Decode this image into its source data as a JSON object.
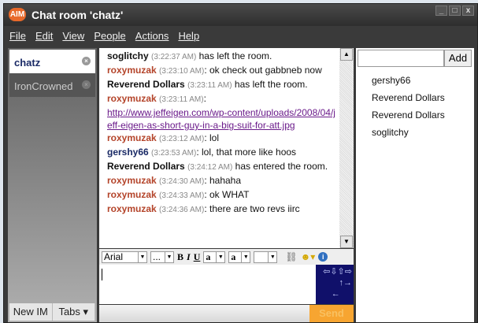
{
  "window": {
    "logo": "AIM",
    "title": "Chat room 'chatz'",
    "controls": [
      "_",
      "□",
      "x"
    ]
  },
  "menu": [
    "File",
    "Edit",
    "View",
    "People",
    "Actions",
    "Help"
  ],
  "sidebar": {
    "tabs": [
      {
        "label": "chatz"
      },
      {
        "label": "IronCrowned"
      }
    ],
    "close": "×",
    "new_im": "New IM",
    "tabs_btn": "Tabs ▾"
  },
  "messages": [
    {
      "name": "soglitchy",
      "color": "k",
      "time": "(3:22:37 AM)",
      "text": " has left the room."
    },
    {
      "name": "roxymuzak",
      "color": "r",
      "time": "(3:23:10 AM)",
      "text": ": ok check out gabbneb now"
    },
    {
      "name": "Reverend Dollars",
      "color": "k",
      "time": "(3:23:11 AM)",
      "text": " has left the room."
    },
    {
      "name": "roxymuzak",
      "color": "r",
      "time": "(3:23:11 AM)",
      "text": ":",
      "link": "http://www.jeffeigen.com/wp-content/uploads/2008/04/jeff-eigen-as-short-guy-in-a-big-suit-for-att.jpg"
    },
    {
      "name": "roxymuzak",
      "color": "r",
      "time": "(3:23:12 AM)",
      "text": ": lol"
    },
    {
      "name": "gershy66",
      "color": "b",
      "time": "(3:23:53 AM)",
      "text": ": lol, that more like hoos"
    },
    {
      "name": "Reverend Dollars",
      "color": "k",
      "time": "(3:24:12 AM)",
      "text": " has entered the room."
    },
    {
      "name": "roxymuzak",
      "color": "r",
      "time": "(3:24:30 AM)",
      "text": ": hahaha"
    },
    {
      "name": "roxymuzak",
      "color": "r",
      "time": "(3:24:33 AM)",
      "text": ": ok WHAT"
    },
    {
      "name": "roxymuzak",
      "color": "r",
      "time": "(3:24:36 AM)",
      "text": ": there are two revs iirc"
    }
  ],
  "toolbar": {
    "font": "Arial",
    "size": "...",
    "bold": "B",
    "italic": "I",
    "underline": "U",
    "fg": "a",
    "bg": "a"
  },
  "input": {
    "value": "",
    "send": "Send"
  },
  "people": {
    "add": "Add",
    "search_value": "",
    "list": [
      "gershy66",
      "Reverend Dollars",
      "Reverend Dollars",
      "soglitchy"
    ]
  }
}
